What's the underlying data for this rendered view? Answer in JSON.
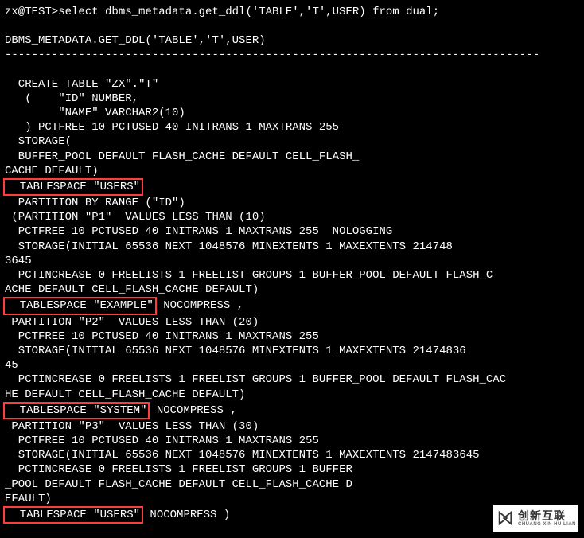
{
  "prompt": "zx@TEST>select dbms_metadata.get_ddl('TABLE','T',USER) from dual;",
  "header": "DBMS_METADATA.GET_DDL('TABLE','T',USER)",
  "dashes": "--------------------------------------------------------------------------------",
  "ddl": {
    "l1": "  CREATE TABLE \"ZX\".\"T\"",
    "l2": "   (    \"ID\" NUMBER,",
    "l3": "        \"NAME\" VARCHAR2(10)",
    "l4": "   ) PCTFREE 10 PCTUSED 40 INITRANS 1 MAXTRANS 255",
    "l5": "  STORAGE(",
    "l6": "  BUFFER_POOL DEFAULT FLASH_CACHE DEFAULT CELL_FLASH_",
    "l7": "CACHE DEFAULT)",
    "l8_hl": "  TABLESPACE \"USERS\"",
    "l9": "  PARTITION BY RANGE (\"ID\")",
    "l10": " (PARTITION \"P1\"  VALUES LESS THAN (10)",
    "l11": "  PCTFREE 10 PCTUSED 40 INITRANS 1 MAXTRANS 255  NOLOGGING",
    "l12": "  STORAGE(INITIAL 65536 NEXT 1048576 MINEXTENTS 1 MAXEXTENTS 214748",
    "l13": "3645",
    "l14": "  PCTINCREASE 0 FREELISTS 1 FREELIST GROUPS 1 BUFFER_POOL DEFAULT FLASH_C",
    "l15": "ACHE DEFAULT CELL_FLASH_CACHE DEFAULT)",
    "l16_hl": "  TABLESPACE \"EXAMPLE\"",
    "l16_tail": " NOCOMPRESS ,",
    "l17": " PARTITION \"P2\"  VALUES LESS THAN (20)",
    "l18": "  PCTFREE 10 PCTUSED 40 INITRANS 1 MAXTRANS 255",
    "l19": "  STORAGE(INITIAL 65536 NEXT 1048576 MINEXTENTS 1 MAXEXTENTS 21474836",
    "l20": "45",
    "l21": "  PCTINCREASE 0 FREELISTS 1 FREELIST GROUPS 1 BUFFER_POOL DEFAULT FLASH_CAC",
    "l22": "HE DEFAULT CELL_FLASH_CACHE DEFAULT)",
    "l23_hl": "  TABLESPACE \"SYSTEM\"",
    "l23_tail": " NOCOMPRESS ,",
    "l24": " PARTITION \"P3\"  VALUES LESS THAN (30)",
    "l25": "  PCTFREE 10 PCTUSED 40 INITRANS 1 MAXTRANS 255",
    "l26": "  STORAGE(INITIAL 65536 NEXT 1048576 MINEXTENTS 1 MAXEXTENTS 2147483645",
    "l27": "  PCTINCREASE 0 FREELISTS 1 FREELIST GROUPS 1 BUFFER",
    "l28": "_POOL DEFAULT FLASH_CACHE DEFAULT CELL_FLASH_CACHE D",
    "l29": "EFAULT)",
    "l30_hl": "  TABLESPACE \"USERS\"",
    "l30_tail": " NOCOMPRESS )"
  },
  "watermark": {
    "cn": "创新互联",
    "py": "CHUANG XIN HU LIAN"
  }
}
